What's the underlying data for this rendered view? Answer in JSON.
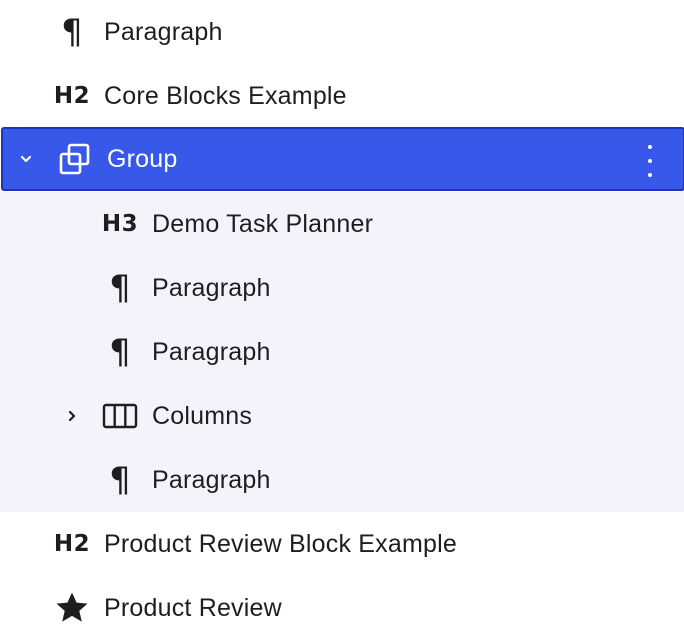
{
  "colors": {
    "selected_bg": "#3858e9",
    "selected_border": "#1e35b8",
    "group_bg": "#f3f4fb",
    "text": "#1e1e1e"
  },
  "blocks": [
    {
      "label": "Paragraph",
      "icon": "paragraph-icon",
      "icon_text": "¶",
      "level": 1
    },
    {
      "label": "Core Blocks Example",
      "icon": "heading-icon",
      "icon_text": "H2",
      "level": 1
    },
    {
      "label": "Group",
      "icon": "group-icon",
      "level": 1,
      "expanded": true,
      "selected": true,
      "children": [
        {
          "label": "Demo Task Planner",
          "icon": "heading-icon",
          "icon_text": "H3",
          "level": 2
        },
        {
          "label": "Paragraph",
          "icon": "paragraph-icon",
          "icon_text": "¶",
          "level": 2
        },
        {
          "label": "Paragraph",
          "icon": "paragraph-icon",
          "icon_text": "¶",
          "level": 2
        },
        {
          "label": "Columns",
          "icon": "columns-icon",
          "level": 2,
          "expanded": false
        },
        {
          "label": "Paragraph",
          "icon": "paragraph-icon",
          "icon_text": "¶",
          "level": 2
        }
      ]
    },
    {
      "label": "Product Review Block Example",
      "icon": "heading-icon",
      "icon_text": "H2",
      "level": 1
    },
    {
      "label": "Product Review",
      "icon": "star-icon",
      "level": 1
    }
  ]
}
